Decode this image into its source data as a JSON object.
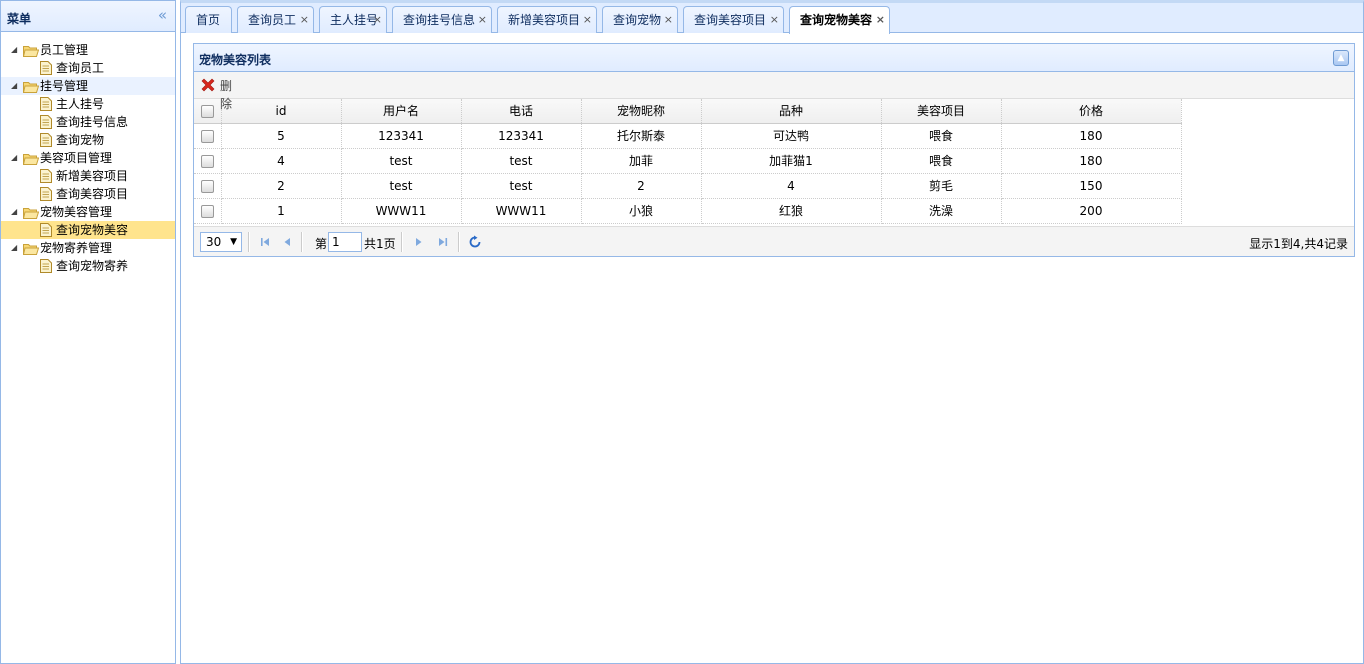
{
  "menu": {
    "title": "菜单",
    "nodes": [
      {
        "label": "员工管理",
        "type": "folder"
      },
      {
        "label": "查询员工",
        "type": "leaf"
      },
      {
        "label": "挂号管理",
        "type": "folder"
      },
      {
        "label": "主人挂号",
        "type": "leaf"
      },
      {
        "label": "查询挂号信息",
        "type": "leaf"
      },
      {
        "label": "查询宠物",
        "type": "leaf"
      },
      {
        "label": "美容项目管理",
        "type": "folder"
      },
      {
        "label": "新增美容项目",
        "type": "leaf"
      },
      {
        "label": "查询美容项目",
        "type": "leaf"
      },
      {
        "label": "宠物美容管理",
        "type": "folder"
      },
      {
        "label": "查询宠物美容",
        "type": "leaf"
      },
      {
        "label": "宠物寄养管理",
        "type": "folder"
      },
      {
        "label": "查询宠物寄养",
        "type": "leaf"
      }
    ]
  },
  "tabs": [
    {
      "label": "首页",
      "closable": false
    },
    {
      "label": "查询员工",
      "closable": true
    },
    {
      "label": "主人挂号",
      "closable": true
    },
    {
      "label": "查询挂号信息",
      "closable": true
    },
    {
      "label": "新增美容项目",
      "closable": true
    },
    {
      "label": "查询宠物",
      "closable": true
    },
    {
      "label": "查询美容项目",
      "closable": true
    },
    {
      "label": "查询宠物美容",
      "closable": true,
      "active": true
    }
  ],
  "grid": {
    "title": "宠物美容列表",
    "toolbar": {
      "delete_label": "删除"
    },
    "columns": [
      "id",
      "用户名",
      "电话",
      "宠物昵称",
      "品种",
      "美容项目",
      "价格"
    ],
    "rows": [
      [
        "5",
        "123341",
        "123341",
        "托尔斯泰",
        "可达鸭",
        "喂食",
        "180"
      ],
      [
        "4",
        "test",
        "test",
        "加菲",
        "加菲猫1",
        "喂食",
        "180"
      ],
      [
        "2",
        "test",
        "test",
        "2",
        "4",
        "剪毛",
        "150"
      ],
      [
        "1",
        "WWW11",
        "WWW11",
        "小狼",
        "红狼",
        "洗澡",
        "200"
      ]
    ],
    "pager": {
      "page_size": "30",
      "page_prefix": "第",
      "page_value": "1",
      "page_total": "共1页",
      "info": "显示1到4,共4记录"
    }
  },
  "colors": {
    "border": "#95b8e7",
    "header_bg": "#e0ecff",
    "selected": "#ffe48d"
  },
  "icons": {
    "collapse": "double-chevron-left-icon",
    "delete": "red-x-icon",
    "refresh": "refresh-icon"
  }
}
